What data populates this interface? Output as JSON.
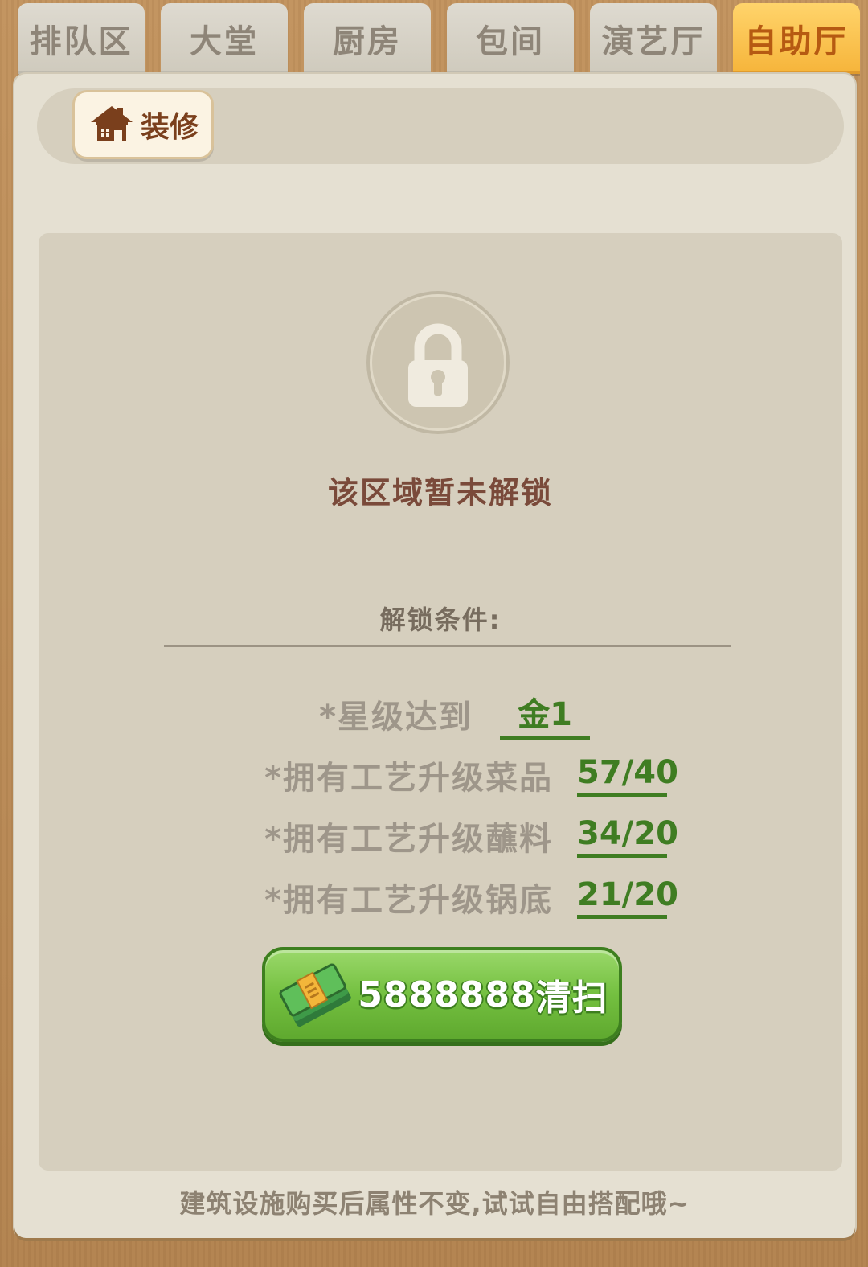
{
  "tabs": [
    {
      "label": "排队区",
      "active": false
    },
    {
      "label": "大堂",
      "active": false
    },
    {
      "label": "厨房",
      "active": false
    },
    {
      "label": "包间",
      "active": false
    },
    {
      "label": "演艺厅",
      "active": false
    },
    {
      "label": "自助厅",
      "active": true
    }
  ],
  "toolbar": {
    "decorate_label": "装修"
  },
  "locked": {
    "icon": "padlock-icon",
    "title": "该区域暂未解锁",
    "conditions_title": "解锁条件:"
  },
  "requirements": [
    {
      "label": "*星级达到",
      "value": "金1"
    },
    {
      "label": "*拥有工艺升级菜品",
      "value": "57/40"
    },
    {
      "label": "*拥有工艺升级蘸料",
      "value": "34/20"
    },
    {
      "label": "*拥有工艺升级锅底",
      "value": "21/20"
    }
  ],
  "clean_button": {
    "cost": "5888888",
    "label": "清扫",
    "icon": "cash-stack-icon"
  },
  "footer": {
    "tip": "建筑设施购买后属性不变,试试自由搭配哦~"
  },
  "colors": {
    "active_tab": "#f6b43a",
    "value_green": "#3f7d22",
    "button_green": "#74c040"
  }
}
